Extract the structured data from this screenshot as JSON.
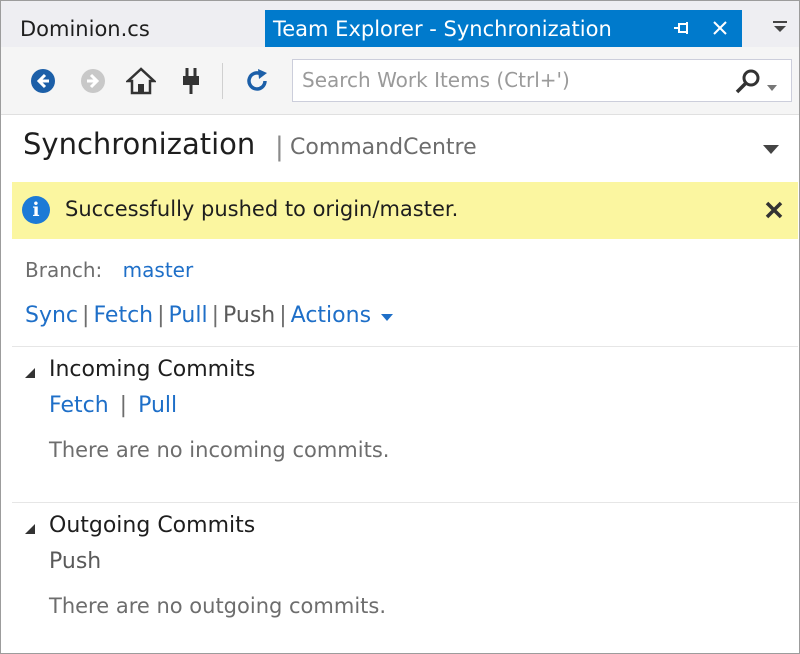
{
  "tabs": {
    "doc_tab": "Dominion.cs",
    "team_explorer_tab": "Team Explorer - Synchronization"
  },
  "toolbar": {
    "search_placeholder": "Search Work Items (Ctrl+')",
    "icons": [
      "back-icon",
      "forward-icon",
      "home-icon",
      "connect-icon",
      "refresh-icon",
      "search-icon",
      "dropdown-icon"
    ]
  },
  "header": {
    "title": "Synchronization",
    "separator": "|",
    "repo": "CommandCentre"
  },
  "notification": {
    "message": "Successfully pushed to origin/master."
  },
  "branch": {
    "label": "Branch:",
    "name": "master"
  },
  "actions": {
    "sync": "Sync",
    "fetch": "Fetch",
    "pull": "Pull",
    "push": "Push",
    "more": "Actions",
    "sep": "|"
  },
  "incoming": {
    "title": "Incoming Commits",
    "fetch": "Fetch",
    "pull": "Pull",
    "sep": "|",
    "empty": "There are no incoming commits."
  },
  "outgoing": {
    "title": "Outgoing Commits",
    "push": "Push",
    "empty": "There are no outgoing commits."
  },
  "colors": {
    "accent": "#007acc",
    "link": "#1e6fc8",
    "notification_bg": "#fbf6a0"
  }
}
